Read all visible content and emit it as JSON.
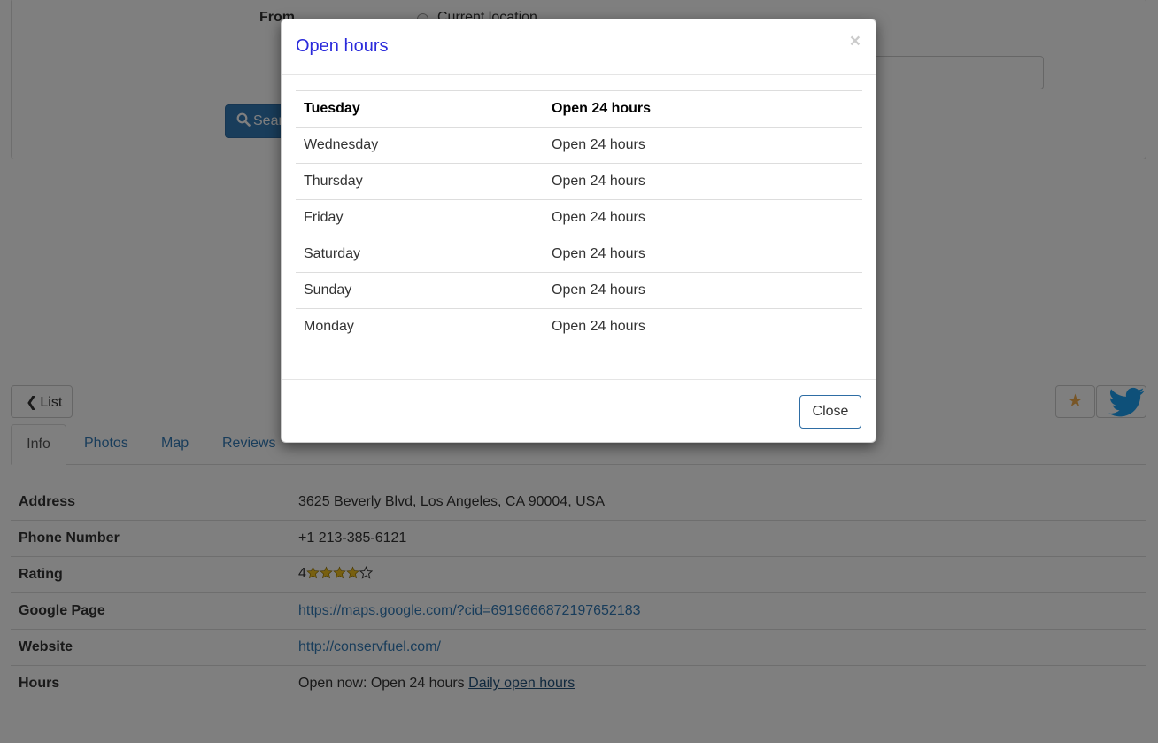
{
  "search": {
    "from_label": "From",
    "current_location_label": "Current location",
    "search_button_label": "Search"
  },
  "nav": {
    "list_button_label": "List"
  },
  "tabs": [
    {
      "label": "Info",
      "active": true
    },
    {
      "label": "Photos",
      "active": false
    },
    {
      "label": "Map",
      "active": false
    },
    {
      "label": "Reviews",
      "active": false
    }
  ],
  "details": {
    "address_label": "Address",
    "address_value": "3625 Beverly Blvd, Los Angeles, CA 90004, USA",
    "phone_label": "Phone Number",
    "phone_value": "+1 213-385-6121",
    "rating_label": "Rating",
    "rating_value": "4",
    "rating_stars_filled": 4,
    "rating_stars_total": 5,
    "google_label": "Google Page",
    "google_value": "https://maps.google.com/?cid=6919666872197652183",
    "website_label": "Website",
    "website_value": "http://conservfuel.com/",
    "hours_label": "Hours",
    "hours_value": "Open now: Open 24 hours",
    "hours_link": "Daily open hours"
  },
  "modal": {
    "title": "Open hours",
    "close_icon": "×",
    "close_button_label": "Close",
    "hours": [
      {
        "day": "Tuesday",
        "hours": "Open 24 hours",
        "today": true
      },
      {
        "day": "Wednesday",
        "hours": "Open 24 hours",
        "today": false
      },
      {
        "day": "Thursday",
        "hours": "Open 24 hours",
        "today": false
      },
      {
        "day": "Friday",
        "hours": "Open 24 hours",
        "today": false
      },
      {
        "day": "Saturday",
        "hours": "Open 24 hours",
        "today": false
      },
      {
        "day": "Sunday",
        "hours": "Open 24 hours",
        "today": false
      },
      {
        "day": "Monday",
        "hours": "Open 24 hours",
        "today": false
      }
    ]
  },
  "colors": {
    "primary": "#337ab7",
    "star": "#f0ad4e",
    "twitter": "#1da1f2",
    "modal_title": "#2a2adb"
  },
  "icons": [
    "search-icon",
    "chevron-left-icon",
    "star-icon",
    "twitter-icon",
    "close-icon"
  ]
}
